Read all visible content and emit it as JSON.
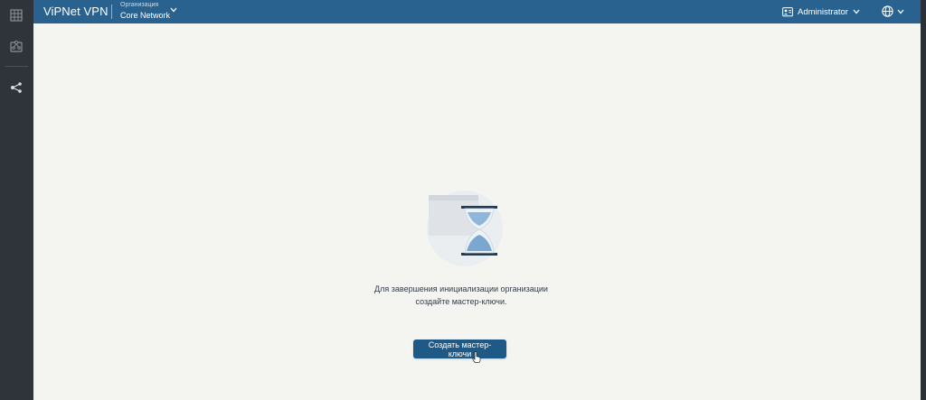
{
  "header": {
    "app_title": "ViPNet VPN",
    "org_caption": "Организация",
    "org_name": "Core Network",
    "user_name": "Administrator"
  },
  "sidebar": {
    "items": [
      {
        "icon": "grid-icon"
      },
      {
        "icon": "network-map-icon"
      },
      {
        "icon": "share-nodes-icon"
      }
    ]
  },
  "main": {
    "message_line1": "Для завершения инициализации организации",
    "message_line2": "создайте мастер-ключи.",
    "create_button_label": "Создать мастер-ключи"
  },
  "colors": {
    "header_bg": "#2a628f",
    "button_bg": "#1f5a86",
    "sidebar_bg": "#2f343b",
    "content_bg": "#f4f4f1"
  }
}
